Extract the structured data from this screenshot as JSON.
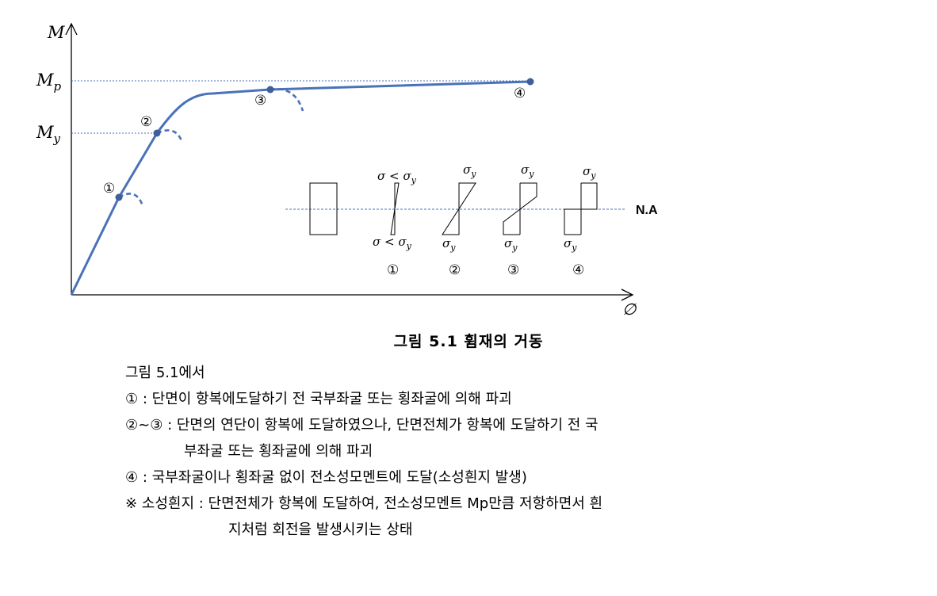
{
  "figure": {
    "axis_y_label": "M",
    "axis_x_label": "∅",
    "tick_mp": {
      "base": "M",
      "sub": "p"
    },
    "tick_my": {
      "base": "M",
      "sub": "y"
    },
    "point_labels": [
      "①",
      "②",
      "③",
      "④"
    ],
    "na_label": "N.A",
    "stress_labels": {
      "s1_top": "σ < σ",
      "s1_top_sub": "y",
      "s1_bottom": "σ < σ",
      "s1_bottom_sub": "y",
      "sigma": "σ",
      "sub": "y"
    },
    "diagram_numbers": [
      "①",
      "②",
      "③",
      "④"
    ],
    "curve_color": "#4a72b8",
    "point_color": "#3f5f9a"
  },
  "caption": "그림 5.1 휨재의 거동",
  "body": {
    "intro": "그림 5.1에서",
    "item1": "① : 단면이 항복에도달하기 전 국부좌굴 또는 횡좌굴에 의해 파괴",
    "item2_line1": "②~③ : 단면의 연단이 항복에 도달하였으나, 단면전체가 항복에 도달하기 전 국",
    "item2_line2": "부좌굴 또는 횡좌굴에 의해 파괴",
    "item3": "④ : 국부좌굴이나 횡좌굴 없이 전소성모멘트에 도달(소성흰지 발생)",
    "note_line1": "※ 소성흰지 : 단면전체가 항복에 도달하여, 전소성모멘트 Mp만큼 저항하면서 흰",
    "note_line2": "지처럼 회전을 발생시키는 상태"
  }
}
